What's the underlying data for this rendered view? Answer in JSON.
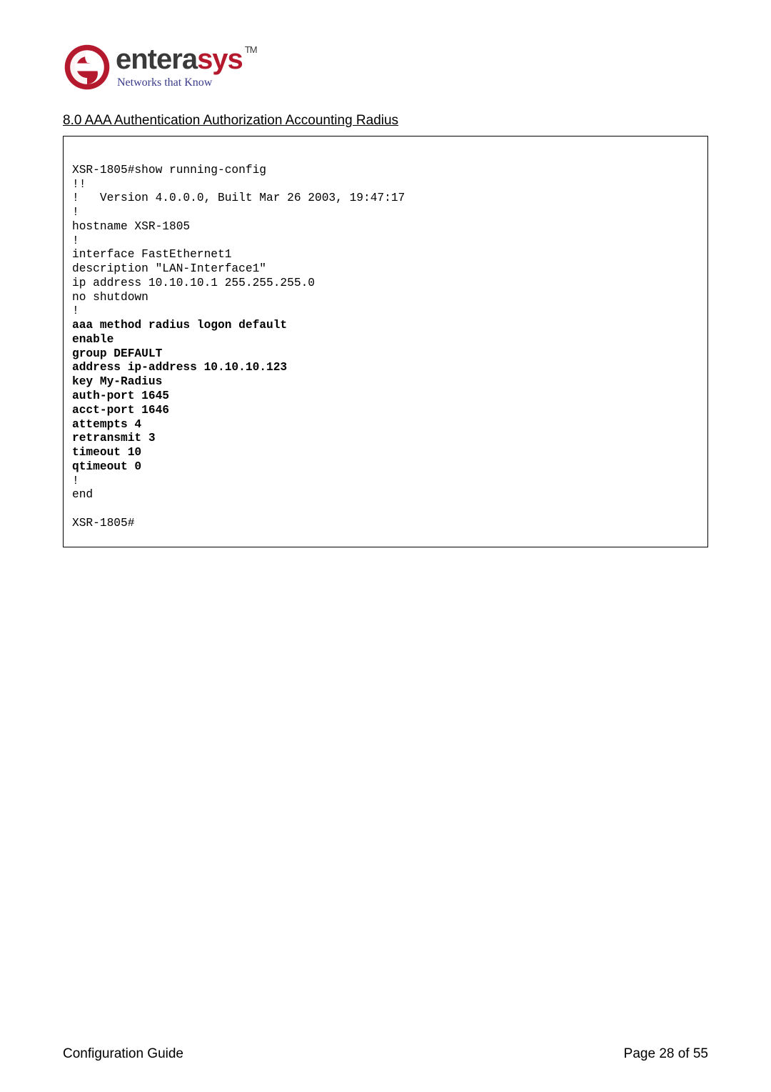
{
  "logo": {
    "brand_part1": "entera",
    "brand_part2": "sys",
    "tm": "TM",
    "tagline": "Networks that Know"
  },
  "heading": "8.0 AAA Authentication Authorization Accounting Radius",
  "code": {
    "l1": "XSR-1805#show running-config",
    "l2": "!!",
    "l3": "!   Version 4.0.0.0, Built Mar 26 2003, 19:47:17",
    "l4": "!",
    "l5": "hostname XSR-1805",
    "l6": "!",
    "l7": "interface FastEthernet1",
    "l8": "description \"LAN-Interface1\"",
    "l9": "ip address 10.10.10.1 255.255.255.0",
    "l10": "no shutdown",
    "l11": "!",
    "l12": "aaa method radius logon default",
    "l13": "enable",
    "l14": "group DEFAULT",
    "l15": "address ip-address 10.10.10.123",
    "l16": "key My-Radius",
    "l17": "auth-port 1645",
    "l18": "acct-port 1646",
    "l19": "attempts 4",
    "l20": "retransmit 3",
    "l21": "timeout 10",
    "l22": "qtimeout 0",
    "l23": "!",
    "l24": "end",
    "l25": "",
    "l26": "XSR-1805#"
  },
  "footer": {
    "left": "Configuration Guide",
    "right": "Page 28 of 55"
  }
}
